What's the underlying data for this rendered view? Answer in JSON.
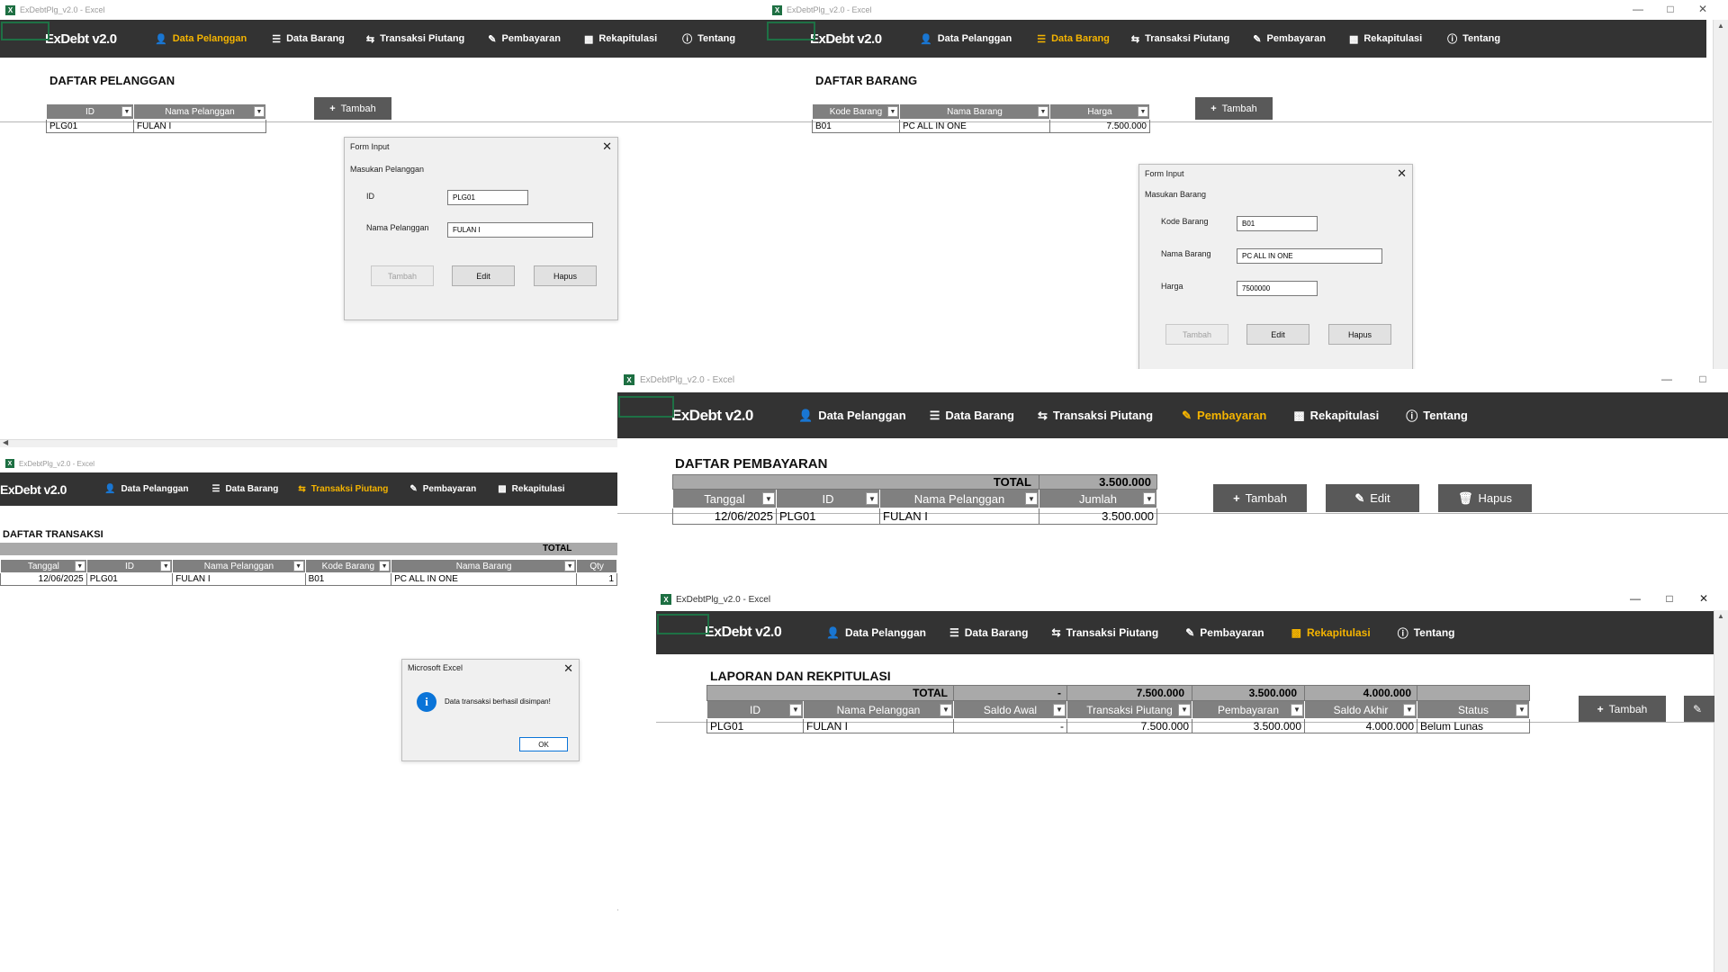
{
  "colors": {
    "nav_bg": "#333333",
    "active": "#f5b400",
    "header_gray": "#808080",
    "total_gray": "#a9a9a9",
    "button_dark": "#595959",
    "excel_green": "#1d6f42",
    "info_blue": "#0a74d8"
  },
  "app": {
    "window_title": "ExDebtPlg_v2.0 - Excel",
    "brand": "ExDebt v2.0",
    "nav": {
      "pelanggan": "Data Pelanggan",
      "barang": "Data Barang",
      "transaksi": "Transaksi Piutang",
      "pembayaran": "Pembayaran",
      "rekap": "Rekapitulasi",
      "tentang": "Tentang"
    },
    "btn_tambah": "Tambah",
    "btn_edit": "Edit",
    "btn_hapus": "Hapus",
    "total_label": "TOTAL"
  },
  "pelanggan": {
    "heading": "DAFTAR PELANGGAN",
    "headers": [
      "ID",
      "Nama Pelanggan"
    ],
    "row": [
      "PLG01",
      "FULAN I"
    ],
    "form": {
      "title": "Form Input",
      "subtitle": "Masukan Pelanggan",
      "id_label": "ID",
      "id_value": "PLG01",
      "nama_label": "Nama Pelanggan",
      "nama_value": "FULAN I",
      "btn_tambah": "Tambah",
      "btn_edit": "Edit",
      "btn_hapus": "Hapus"
    }
  },
  "barang": {
    "heading": "DAFTAR BARANG",
    "headers": [
      "Kode Barang",
      "Nama Barang",
      "Harga"
    ],
    "row": [
      "B01",
      "PC ALL IN ONE",
      "7.500.000"
    ],
    "form": {
      "title": "Form Input",
      "subtitle": "Masukan Barang",
      "kode_label": "Kode Barang",
      "kode_value": "B01",
      "nama_label": "Nama Barang",
      "nama_value": "PC ALL IN ONE",
      "harga_label": "Harga",
      "harga_value": "7500000",
      "btn_tambah": "Tambah",
      "btn_edit": "Edit",
      "btn_hapus": "Hapus"
    }
  },
  "transaksi": {
    "heading": "DAFTAR TRANSAKSI",
    "headers": [
      "Tanggal",
      "ID",
      "Nama Pelanggan",
      "Kode Barang",
      "Nama Barang",
      "Qty"
    ],
    "row": [
      "12/06/2025",
      "PLG01",
      "FULAN I",
      "B01",
      "PC ALL IN ONE",
      "1"
    ],
    "msgbox": {
      "title": "Microsoft Excel",
      "message": "Data transaksi berhasil disimpan!",
      "ok": "OK",
      "icon": "info-icon"
    }
  },
  "pembayaran": {
    "heading": "DAFTAR PEMBAYARAN",
    "total_value": "3.500.000",
    "headers": [
      "Tanggal",
      "ID",
      "Nama Pelanggan",
      "Jumlah"
    ],
    "row": [
      "12/06/2025",
      "PLG01",
      "FULAN I",
      "3.500.000"
    ]
  },
  "rekap": {
    "heading": "LAPORAN DAN REKPITULASI",
    "totals": [
      "-",
      "7.500.000",
      "3.500.000",
      "4.000.000"
    ],
    "headers": [
      "ID",
      "Nama Pelanggan",
      "Saldo Awal",
      "Transaksi Piutang",
      "Pembayaran",
      "Saldo Akhir",
      "Status"
    ],
    "row": [
      "PLG01",
      "FULAN I",
      "-",
      "7.500.000",
      "3.500.000",
      "4.000.000",
      "Belum Lunas"
    ]
  }
}
